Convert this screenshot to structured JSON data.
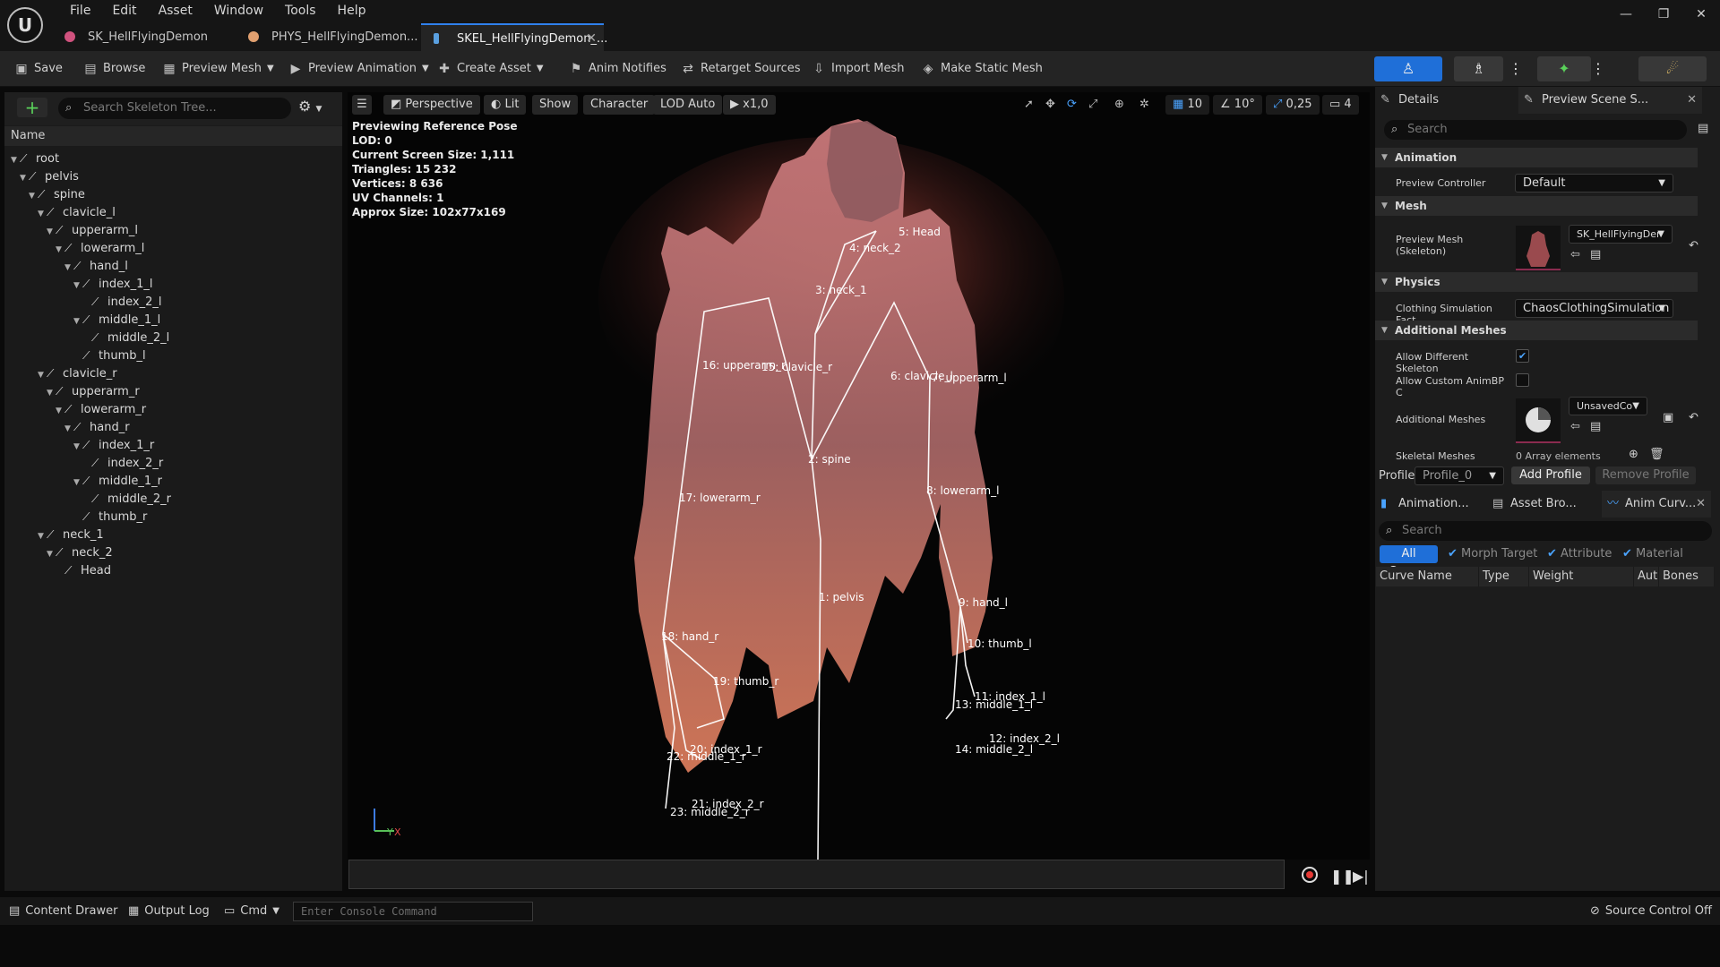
{
  "app": {
    "logo": "U",
    "menu": [
      "File",
      "Edit",
      "Asset",
      "Window",
      "Tools",
      "Help"
    ],
    "tabs": [
      {
        "label": "SK_HellFlyingDemon",
        "icon": "skeletal-mesh-icon",
        "icon_color": "#d0527e"
      },
      {
        "label": "PHYS_HellFlyingDemon...",
        "icon": "physics-asset-icon",
        "icon_color": "#e0a070"
      },
      {
        "label": "SKEL_HellFlyingDemon_...",
        "icon": "skeleton-icon",
        "icon_color": "#5aa0e0"
      }
    ],
    "window_controls": {
      "minimize": "—",
      "restore": "❐",
      "close": "✕"
    }
  },
  "toolbar": {
    "save": "Save",
    "browse": "Browse",
    "preview_mesh": "Preview Mesh",
    "preview_animation": "Preview Animation",
    "create_asset": "Create Asset",
    "anim_notifies": "Anim Notifies",
    "retarget_sources": "Retarget Sources",
    "import_mesh": "Import Mesh",
    "make_static_mesh": "Make Static Mesh",
    "accent": "#1f6fd8"
  },
  "skeleton_tree": {
    "search_placeholder": "Search Skeleton Tree...",
    "column": "Name",
    "bones": [
      {
        "name": "root",
        "depth": 0,
        "expanded": true
      },
      {
        "name": "pelvis",
        "depth": 1,
        "expanded": true
      },
      {
        "name": "spine",
        "depth": 2,
        "expanded": true
      },
      {
        "name": "clavicle_l",
        "depth": 3,
        "expanded": true
      },
      {
        "name": "upperarm_l",
        "depth": 4,
        "expanded": true
      },
      {
        "name": "lowerarm_l",
        "depth": 5,
        "expanded": true
      },
      {
        "name": "hand_l",
        "depth": 6,
        "expanded": true
      },
      {
        "name": "index_1_l",
        "depth": 7,
        "expanded": true
      },
      {
        "name": "index_2_l",
        "depth": 8,
        "expanded": false
      },
      {
        "name": "middle_1_l",
        "depth": 7,
        "expanded": true
      },
      {
        "name": "middle_2_l",
        "depth": 8,
        "expanded": false
      },
      {
        "name": "thumb_l",
        "depth": 7,
        "expanded": false
      },
      {
        "name": "clavicle_r",
        "depth": 3,
        "expanded": true
      },
      {
        "name": "upperarm_r",
        "depth": 4,
        "expanded": true
      },
      {
        "name": "lowerarm_r",
        "depth": 5,
        "expanded": true
      },
      {
        "name": "hand_r",
        "depth": 6,
        "expanded": true
      },
      {
        "name": "index_1_r",
        "depth": 7,
        "expanded": true
      },
      {
        "name": "index_2_r",
        "depth": 8,
        "expanded": false
      },
      {
        "name": "middle_1_r",
        "depth": 7,
        "expanded": true
      },
      {
        "name": "middle_2_r",
        "depth": 8,
        "expanded": false
      },
      {
        "name": "thumb_r",
        "depth": 7,
        "expanded": false
      },
      {
        "name": "neck_1",
        "depth": 3,
        "expanded": true
      },
      {
        "name": "neck_2",
        "depth": 4,
        "expanded": true
      },
      {
        "name": "Head",
        "depth": 5,
        "expanded": false
      }
    ]
  },
  "viewport": {
    "perspective": "Perspective",
    "lit": "Lit",
    "show": "Show",
    "character": "Character",
    "lod": "LOD Auto",
    "speed": "x1,0",
    "grid_value": "10",
    "angle_value": "10°",
    "scale_value": "0,25",
    "camera_value": "4",
    "info": [
      "Previewing Reference Pose",
      "LOD: 0",
      "Current Screen Size: 1,111",
      "Triangles: 15 232",
      "Vertices: 8 636",
      "UV Channels: 1",
      "Approx Size: 102x77x169"
    ],
    "bone_labels": [
      "5: Head",
      "4: neck_2",
      "3: neck_1",
      "16: upperarm_r",
      "15: clavicle_r",
      "6: clavicle_l",
      "7: upperarm_l",
      "2: spine",
      "17: lowerarm_r",
      "8: lowerarm_l",
      "1: pelvis",
      "9: hand_l",
      "18: hand_r",
      "10: thumb_l",
      "19: thumb_r",
      "11: index_1_l",
      "13: middle_1_l",
      "12: index_2_l",
      "14: middle_2_l",
      "20: index_1_r",
      "22: middle_1_r",
      "21: index_2_r",
      "23: middle_2_r"
    ],
    "axis_label": "Y X"
  },
  "details": {
    "tab_details": "Details",
    "tab_preview": "Preview Scene S...",
    "search_placeholder": "Search",
    "sections": {
      "animation": "Animation",
      "mesh": "Mesh",
      "physics": "Physics",
      "additional_meshes": "Additional Meshes"
    },
    "preview_controller_label": "Preview Controller",
    "preview_controller_value": "Default",
    "preview_mesh_label": "Preview Mesh (Skeleton)",
    "preview_mesh_value": "SK_HellFlyingDer",
    "clothing_label": "Clothing Simulation Fact",
    "clothing_value": "ChaosClothingSimulation",
    "allow_diff_skel_label": "Allow Different Skeleton",
    "allow_diff_skel_checked": true,
    "allow_custom_animbp_label": "Allow Custom AnimBP C",
    "allow_custom_animbp_checked": false,
    "additional_meshes_label": "Additional Meshes",
    "additional_meshes_value": "UnsavedCo",
    "skeletal_meshes_label": "Skeletal Meshes",
    "skeletal_meshes_value": "0 Array elements",
    "profile_label": "Profile",
    "profile_value": "Profile_0",
    "add_profile": "Add Profile",
    "remove_profile": "Remove Profile"
  },
  "curves": {
    "tabs": [
      "Animation...",
      "Asset Bro...",
      "Anim Curv..."
    ],
    "search_placeholder": "Search",
    "filters": {
      "all": "All Curves",
      "morph": "Morph Target",
      "attribute": "Attribute",
      "material": "Material"
    },
    "columns": [
      "Curve Name",
      "Type",
      "Weight",
      "Auto",
      "Bones"
    ]
  },
  "statusbar": {
    "content_drawer": "Content Drawer",
    "output_log": "Output Log",
    "cmd": "Cmd",
    "console_placeholder": "Enter Console Command",
    "source_control": "Source Control Off"
  }
}
